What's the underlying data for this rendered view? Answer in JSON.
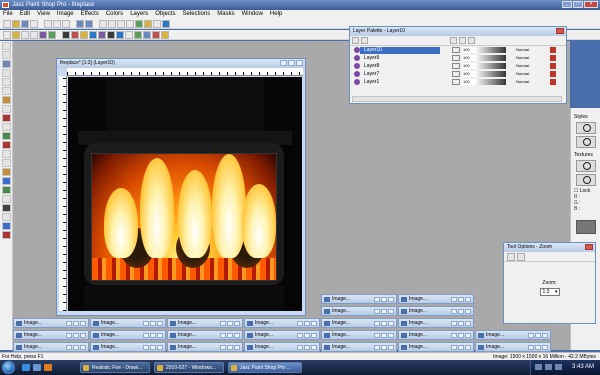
{
  "window": {
    "title": "Jasc Paint Shop Pro - fireplace"
  },
  "menu": [
    "File",
    "Edit",
    "View",
    "Image",
    "Effects",
    "Colors",
    "Layers",
    "Objects",
    "Selections",
    "Masks",
    "Window",
    "Help"
  ],
  "image_window": {
    "title": "fireplace* [1:3] (Layer10)"
  },
  "layer_palette": {
    "title": "Layer Palette - Layer10",
    "layers": [
      {
        "name": "Layer10",
        "opacity": "100",
        "blend": "Normal",
        "selected": true
      },
      {
        "name": "Layer9",
        "opacity": "100",
        "blend": "Normal",
        "selected": false
      },
      {
        "name": "Layer8",
        "opacity": "100",
        "blend": "Normal",
        "selected": false
      },
      {
        "name": "Layer7",
        "opacity": "100",
        "blend": "Normal",
        "selected": false
      },
      {
        "name": "Layer1",
        "opacity": "100",
        "blend": "Normal",
        "selected": false
      }
    ]
  },
  "right_panel": {
    "styles_label": "Styles",
    "textures_label": "Textures",
    "lock_label": "Lock",
    "r_label": "R",
    "g_label": "G",
    "b_label": "B"
  },
  "tool_options": {
    "title": "Tool Options - Zoom",
    "zoom_label": "Zoom:",
    "zoom_value": "1:3"
  },
  "minimized": {
    "label": "Image...",
    "count": 30
  },
  "status": {
    "left": "For Help, press F1",
    "right": "Image: 1500 x 1500 x 16 Million - 42.2 MBytes"
  },
  "taskbar": {
    "tasks": [
      {
        "label": "Realistic Fire - Drawi...",
        "active": false
      },
      {
        "label": "2010-027 - Windows...",
        "active": false
      },
      {
        "label": "Jasc Paint Shop Pro ...",
        "active": true
      }
    ],
    "clock": "3:43 AM"
  }
}
